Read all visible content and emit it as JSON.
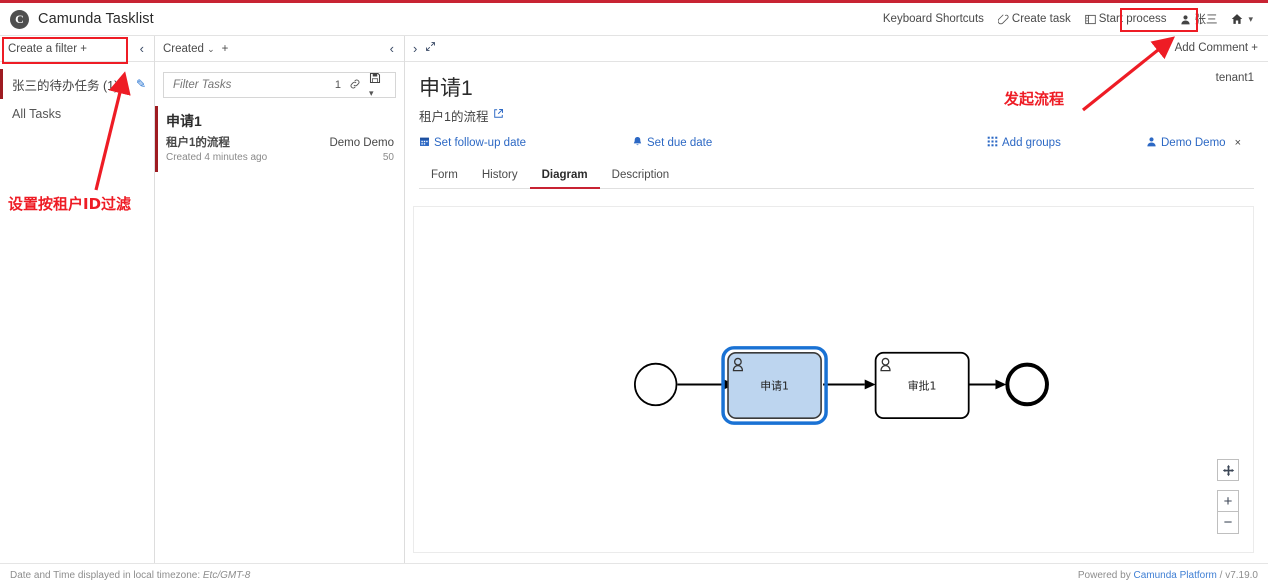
{
  "app": {
    "brand_letter": "C",
    "title": "Camunda Tasklist"
  },
  "topbar": {
    "keyboard_shortcuts": "Keyboard Shortcuts",
    "create_task": "Create task",
    "start_process": "Start process",
    "user_name": "张三",
    "home_caret": "▾"
  },
  "filters": {
    "header_label": "Create a filter +",
    "collapse_icon": "‹",
    "items": [
      {
        "label": "张三的待办任务 (1)",
        "selected": true,
        "edit_icon": "✎"
      },
      {
        "label": "All Tasks",
        "selected": false,
        "edit_icon": ""
      }
    ]
  },
  "tasks": {
    "sort_label": "Created",
    "sort_caret": "⌄",
    "add_label": "+",
    "collapse_icon": "‹",
    "search": {
      "placeholder": "Filter Tasks",
      "value": "",
      "count": "1",
      "link_icon": "🔗",
      "save_icon": "▤",
      "save_caret": "▾"
    },
    "list": [
      {
        "title": "申请1",
        "process": "租户1的流程",
        "assignee": "Demo Demo",
        "created": "Created 4 minutes ago",
        "priority": "50"
      }
    ]
  },
  "detail": {
    "expand_icon": "›",
    "maximize_icon": "⤢",
    "add_comment": "Add Comment +",
    "title": "申请1",
    "tenant": "tenant1",
    "process_name": "租户1的流程",
    "external_link_icon": "↗",
    "actions": {
      "follow_up": "Set follow-up date",
      "follow_up_icon": "▦",
      "due": "Set due date",
      "due_icon": "🔔",
      "groups": "Add groups",
      "groups_icon": "▦",
      "assignee": "Demo Demo",
      "assignee_icon": "👤",
      "assignee_remove": "×"
    },
    "tabs": [
      {
        "label": "Form",
        "active": false
      },
      {
        "label": "History",
        "active": false
      },
      {
        "label": "Diagram",
        "active": true
      },
      {
        "label": "Description",
        "active": false
      }
    ],
    "zoom_controls": {
      "fit_icon": "✥",
      "zoom_in": "+",
      "zoom_out": "−"
    }
  },
  "diagram": {
    "type": "bpmn",
    "elements": [
      {
        "kind": "start-event",
        "label": ""
      },
      {
        "kind": "user-task",
        "label": "申请1",
        "selected": true
      },
      {
        "kind": "user-task",
        "label": "审批1",
        "selected": false
      },
      {
        "kind": "end-event",
        "label": ""
      }
    ]
  },
  "footer": {
    "timezone_prefix": "Date and Time displayed in local timezone: ",
    "timezone": "Etc/GMT-8",
    "powered_prefix": "Powered by ",
    "powered_link": "Camunda Platform",
    "version": " / v7.19.0"
  },
  "annotations": {
    "left_note": "设置按租户ID过滤",
    "right_note": "发起流程",
    "accent_red": "#ee1c25"
  }
}
